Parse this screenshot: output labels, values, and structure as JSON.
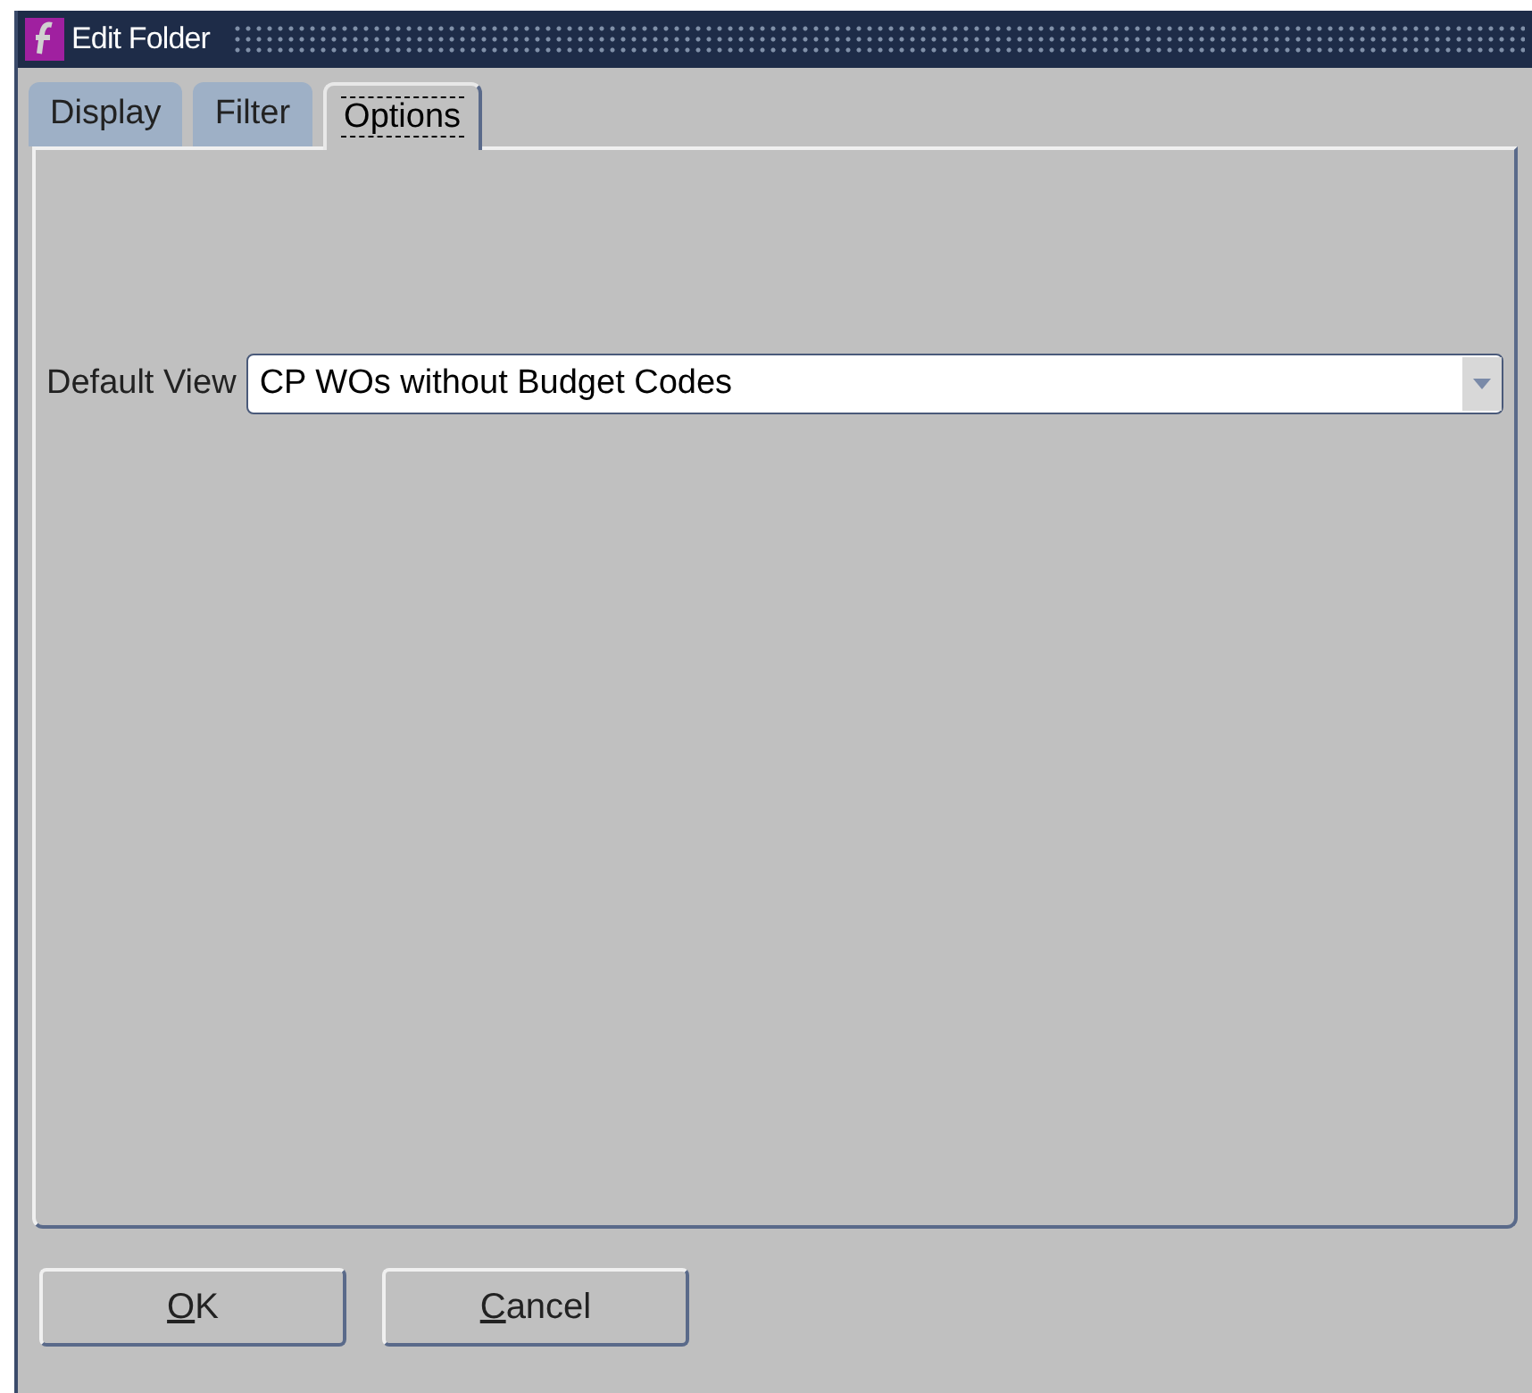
{
  "window": {
    "title": "Edit Folder"
  },
  "tabs": [
    {
      "label": "Display",
      "selected": false
    },
    {
      "label": "Filter",
      "selected": false
    },
    {
      "label": "Options",
      "selected": true
    }
  ],
  "fields": [
    {
      "label": "Default View",
      "value": "CP WOs without Budget Codes"
    }
  ],
  "buttons": [
    {
      "label": "OK",
      "underline_first": true
    },
    {
      "label": "Cancel",
      "underline_first": true
    }
  ]
}
